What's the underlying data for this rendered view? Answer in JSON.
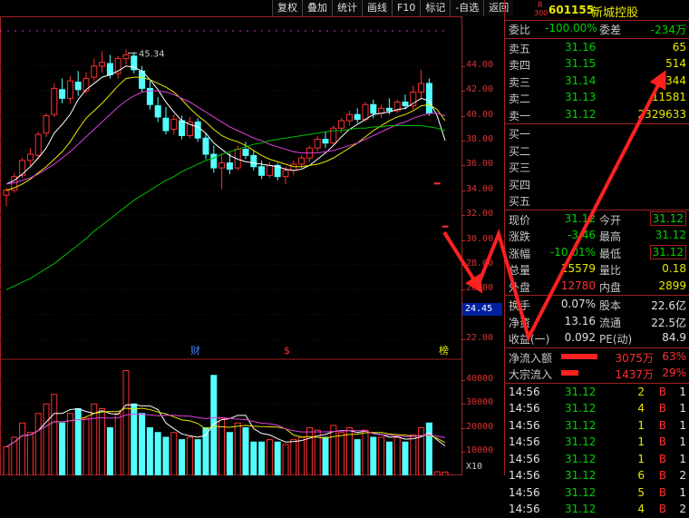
{
  "toolbar": [
    "复权",
    "叠加",
    "统计",
    "画线",
    "F10",
    "标记",
    "-自选",
    "返回"
  ],
  "stock": {
    "badge_top": "R",
    "badge_bottom": "300",
    "code": "601155",
    "name": "新城控股"
  },
  "colors": {
    "up": "#ff3030",
    "down": "#54ffff",
    "ma5": "#ffffff",
    "ma10": "#e8e800",
    "ma20": "#e040e0",
    "ma60": "#00c000",
    "panel_border": "#a02020"
  },
  "chart": {
    "high_label": "45.34",
    "price_ticks": [
      "44.00",
      "42.00",
      "40.00",
      "38.00",
      "36.00",
      "34.00",
      "32.00",
      "30.00",
      "28.00",
      "26.00",
      "24.00",
      "22.00"
    ],
    "cursor_price": "24.45",
    "volume_ticks": [
      "40000",
      "30000",
      "20000",
      "10000"
    ],
    "volume_unit": "X10",
    "markers": [
      "财",
      "$",
      "榜"
    ]
  },
  "chart_data": {
    "type": "candlestick",
    "ylim": [
      20.4,
      48.0
    ],
    "y_ticks": [
      44,
      42,
      40,
      38,
      36,
      34,
      32,
      30,
      28,
      26,
      24,
      22
    ],
    "high_annotation": 45.34,
    "candles": [
      [
        33.6,
        34.2,
        32.7,
        34.0
      ],
      [
        34.0,
        35.4,
        33.8,
        35.1
      ],
      [
        35.2,
        36.6,
        35.0,
        36.4
      ],
      [
        36.4,
        37.4,
        36.0,
        36.9
      ],
      [
        36.8,
        38.7,
        36.5,
        38.5
      ],
      [
        38.6,
        40.2,
        38.3,
        40.0
      ],
      [
        40.1,
        42.6,
        39.9,
        42.2
      ],
      [
        42.1,
        43.0,
        41.0,
        41.4
      ],
      [
        41.4,
        43.2,
        41.0,
        42.8
      ],
      [
        42.7,
        43.6,
        41.6,
        42.1
      ],
      [
        42.0,
        43.5,
        41.8,
        43.0
      ],
      [
        43.1,
        44.6,
        42.8,
        44.0
      ],
      [
        44.0,
        45.2,
        43.5,
        44.3
      ],
      [
        44.2,
        44.9,
        43.0,
        43.3
      ],
      [
        43.4,
        44.8,
        43.0,
        44.6
      ],
      [
        44.6,
        45.34,
        44.1,
        44.9
      ],
      [
        44.8,
        45.1,
        43.4,
        43.7
      ],
      [
        43.6,
        44.0,
        41.9,
        42.2
      ],
      [
        42.2,
        42.8,
        40.5,
        40.9
      ],
      [
        40.8,
        41.5,
        39.5,
        39.9
      ],
      [
        39.8,
        40.7,
        38.5,
        38.8
      ],
      [
        38.9,
        40.1,
        38.5,
        39.7
      ],
      [
        39.6,
        40.0,
        38.1,
        38.4
      ],
      [
        38.4,
        39.9,
        38.2,
        39.5
      ],
      [
        39.5,
        39.8,
        37.9,
        38.2
      ],
      [
        38.2,
        38.6,
        36.5,
        36.9
      ],
      [
        36.9,
        37.6,
        35.4,
        35.8
      ],
      [
        35.8,
        36.9,
        34.1,
        36.2
      ],
      [
        36.2,
        37.0,
        35.3,
        35.7
      ],
      [
        35.8,
        37.6,
        35.6,
        37.3
      ],
      [
        37.3,
        37.9,
        36.5,
        36.8
      ],
      [
        36.8,
        37.2,
        35.6,
        35.9
      ],
      [
        35.9,
        36.4,
        34.9,
        35.2
      ],
      [
        35.2,
        36.3,
        35.0,
        36.0
      ],
      [
        36.0,
        36.2,
        34.8,
        35.1
      ],
      [
        35.1,
        35.9,
        34.5,
        35.6
      ],
      [
        35.6,
        36.4,
        35.2,
        36.1
      ],
      [
        36.1,
        36.8,
        35.8,
        36.6
      ],
      [
        36.6,
        37.6,
        36.3,
        37.4
      ],
      [
        37.4,
        38.4,
        37.1,
        38.1
      ],
      [
        38.1,
        38.7,
        37.4,
        37.8
      ],
      [
        37.8,
        39.2,
        37.6,
        39.0
      ],
      [
        39.0,
        39.8,
        38.6,
        39.6
      ],
      [
        39.6,
        40.4,
        39.2,
        40.1
      ],
      [
        40.1,
        40.6,
        39.4,
        39.7
      ],
      [
        39.7,
        41.1,
        39.5,
        40.9
      ],
      [
        40.9,
        41.3,
        39.8,
        40.2
      ],
      [
        40.2,
        40.9,
        39.8,
        40.6
      ],
      [
        40.6,
        41.4,
        40.1,
        40.4
      ],
      [
        40.4,
        41.3,
        40.2,
        41.1
      ],
      [
        41.1,
        41.7,
        40.5,
        40.8
      ],
      [
        40.8,
        42.4,
        40.5,
        41.9
      ],
      [
        41.9,
        43.7,
        41.4,
        42.6
      ],
      [
        42.6,
        43.0,
        40.0,
        40.2
      ],
      [
        34.58,
        34.58,
        34.58,
        34.58
      ],
      [
        31.12,
        31.12,
        31.12,
        31.12
      ]
    ],
    "ma5": [
      34.5,
      34.8,
      35.3,
      35.9,
      36.6,
      37.4,
      38.6,
      39.3,
      40.1,
      41.3,
      42.1,
      42.6,
      43.1,
      43.3,
      43.6,
      44.0,
      43.9,
      43.6,
      42.9,
      42.1,
      41.1,
      40.3,
      39.6,
      39.3,
      39.1,
      38.6,
      37.8,
      37.3,
      36.8,
      36.5,
      36.3,
      36.2,
      36.1,
      36.0,
      35.9,
      35.7,
      35.6,
      35.7,
      36.0,
      36.5,
      37.0,
      37.6,
      38.3,
      38.9,
      39.3,
      39.7,
      40.1,
      40.2,
      40.3,
      40.5,
      40.6,
      41.0,
      41.4,
      41.2,
      40.0,
      38.0
    ],
    "ma10": [
      34.0,
      34.2,
      34.5,
      34.9,
      35.4,
      35.9,
      36.5,
      37.1,
      37.9,
      38.9,
      39.8,
      40.4,
      41.0,
      41.7,
      42.4,
      43.0,
      43.1,
      43.1,
      42.9,
      42.6,
      42.3,
      41.9,
      41.3,
      40.6,
      40.0,
      39.5,
      38.9,
      38.4,
      38.1,
      37.9,
      37.6,
      37.2,
      36.8,
      36.5,
      36.3,
      36.1,
      35.9,
      35.9,
      36.0,
      36.1,
      36.3,
      36.6,
      37.0,
      37.4,
      37.8,
      38.3,
      38.8,
      39.2,
      39.6,
      39.9,
      40.1,
      40.4,
      40.8,
      40.9,
      40.5,
      39.6
    ],
    "ma20": [
      34.5,
      34.6,
      34.8,
      35.0,
      35.3,
      35.7,
      36.1,
      36.6,
      37.1,
      37.7,
      38.3,
      38.9,
      39.5,
      40.1,
      40.7,
      41.2,
      41.6,
      41.9,
      42.0,
      42.0,
      41.9,
      41.7,
      41.4,
      41.1,
      40.7,
      40.3,
      39.9,
      39.5,
      39.1,
      38.8,
      38.5,
      38.2,
      38.0,
      37.7,
      37.5,
      37.3,
      37.1,
      37.0,
      37.0,
      37.0,
      37.1,
      37.2,
      37.4,
      37.6,
      37.8,
      38.1,
      38.4,
      38.7,
      39.0,
      39.3,
      39.5,
      39.8,
      40.0,
      40.2,
      40.2,
      40.0
    ],
    "ma60": [
      26.0,
      26.3,
      26.6,
      26.9,
      27.3,
      27.7,
      28.1,
      28.6,
      29.1,
      29.6,
      30.1,
      30.7,
      31.2,
      31.7,
      32.2,
      32.7,
      33.2,
      33.6,
      34.0,
      34.4,
      34.8,
      35.1,
      35.5,
      35.8,
      36.1,
      36.4,
      36.6,
      36.9,
      37.1,
      37.3,
      37.5,
      37.7,
      37.8,
      38.0,
      38.1,
      38.2,
      38.3,
      38.4,
      38.5,
      38.6,
      38.7,
      38.8,
      38.8,
      38.9,
      39.0,
      39.0,
      39.1,
      39.1,
      39.2,
      39.2,
      39.2,
      39.2,
      39.2,
      39.1,
      39.0,
      38.8
    ],
    "volume": [
      12000,
      16000,
      22000,
      18000,
      26000,
      30000,
      34000,
      22000,
      26000,
      28000,
      24000,
      30000,
      28000,
      20000,
      26000,
      44000,
      30000,
      26000,
      20000,
      18000,
      16000,
      18000,
      15000,
      16000,
      15000,
      20000,
      42000,
      24000,
      18000,
      22000,
      20000,
      14000,
      14000,
      15000,
      14000,
      13000,
      15000,
      16000,
      20000,
      19000,
      16000,
      21000,
      18000,
      20000,
      15000,
      19000,
      16000,
      16000,
      14000,
      16000,
      14000,
      17000,
      20000,
      22000,
      1500,
      1400
    ],
    "volume_ylim": [
      0,
      48000
    ]
  },
  "order_book": {
    "ratio": {
      "label": "委比",
      "value": "-100.00%",
      "diff_label": "委差",
      "diff": "-234万"
    },
    "asks": [
      {
        "label": "卖五",
        "price": "31.16",
        "vol": "65"
      },
      {
        "label": "卖四",
        "price": "31.15",
        "vol": "514"
      },
      {
        "label": "卖三",
        "price": "31.14",
        "vol": "344"
      },
      {
        "label": "卖二",
        "price": "31.13",
        "vol": "11581"
      },
      {
        "label": "卖一",
        "price": "31.12",
        "vol": "2329633"
      }
    ],
    "bids": [
      {
        "label": "买一"
      },
      {
        "label": "买二"
      },
      {
        "label": "买三"
      },
      {
        "label": "买四"
      },
      {
        "label": "买五"
      }
    ]
  },
  "quote": {
    "price_label": "现价",
    "price": "31.12",
    "open_label": "今开",
    "open": "31.12",
    "change_label": "涨跌",
    "change": "-3.46",
    "high_label": "最高",
    "high": "31.12",
    "pct_label": "涨幅",
    "pct": "-10.01%",
    "low_label": "最低",
    "low": "31.12",
    "volume_label": "总量",
    "volume": "15579",
    "vr_label": "量比",
    "vr": "0.18",
    "outer_label": "外盘",
    "outer": "12780",
    "inner_label": "内盘",
    "inner": "2899",
    "turnover_label": "换手",
    "turnover": "0.07%",
    "shares_label": "股本",
    "shares": "22.6亿",
    "nav_label": "净资",
    "nav": "13.16",
    "float_label": "流通",
    "float": "22.5亿",
    "eps_label": "收益(一)",
    "eps": "0.092",
    "pe_label": "PE(动)",
    "pe": "84.9"
  },
  "flows": [
    {
      "label": "净流入额",
      "value": "3075万",
      "pct": "63%",
      "bar": 0.63
    },
    {
      "label": "大宗流入",
      "value": "1437万",
      "pct": "29%",
      "bar": 0.29
    }
  ],
  "ticks": [
    {
      "time": "14:56",
      "price": "31.12",
      "vol": "2",
      "side": "B",
      "count": "1"
    },
    {
      "time": "14:56",
      "price": "31.12",
      "vol": "4",
      "side": "B",
      "count": "1"
    },
    {
      "time": "14:56",
      "price": "31.12",
      "vol": "1",
      "side": "B",
      "count": "1"
    },
    {
      "time": "14:56",
      "price": "31.12",
      "vol": "1",
      "side": "B",
      "count": "1"
    },
    {
      "time": "14:56",
      "price": "31.12",
      "vol": "1",
      "side": "B",
      "count": "1"
    },
    {
      "time": "14:56",
      "price": "31.12",
      "vol": "6",
      "side": "B",
      "count": "2"
    },
    {
      "time": "14:56",
      "price": "31.12",
      "vol": "5",
      "side": "B",
      "count": "1"
    },
    {
      "time": "14:56",
      "price": "31.12",
      "vol": "4",
      "side": "B",
      "count": "2"
    }
  ]
}
